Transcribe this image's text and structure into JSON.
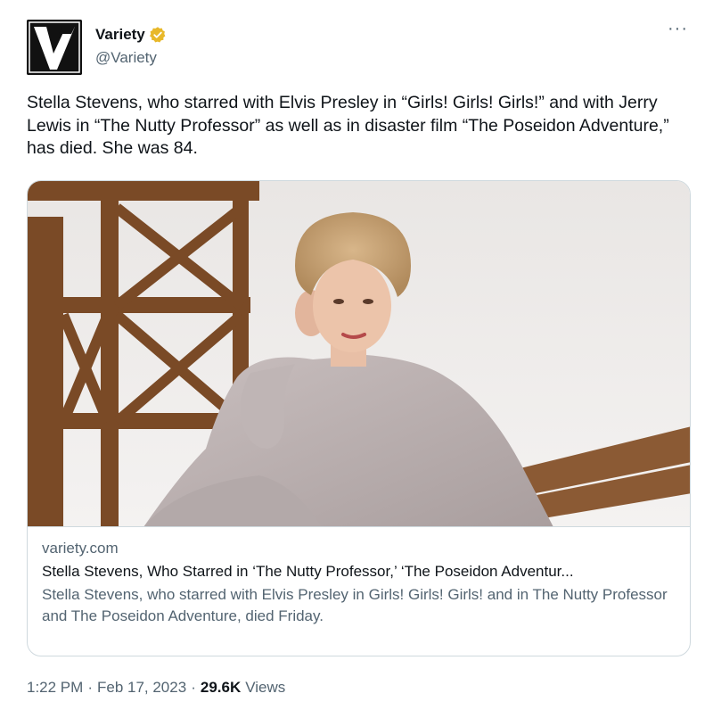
{
  "author": {
    "display_name": "Variety",
    "handle": "@Variety",
    "verified_icon": "verified-badge-icon",
    "verified_color": "#e8b829",
    "avatar_icon": "variety-logo"
  },
  "more_menu": {
    "label": "···"
  },
  "tweet": {
    "text": "Stella Stevens, who starred with Elvis Presley in “Girls! Girls! Girls!” and with Jerry Lewis in “The Nutty Professor” as well as in disaster film “The Poseidon Adventure,” has died. She was 84."
  },
  "card": {
    "domain": "variety.com",
    "title": "Stella Stevens, Who Starred in ‘The Nutty Professor,’ ‘The Poseidon Adventur...",
    "description": "Stella Stevens, who starred with Elvis Presley in Girls! Girls! Girls! and in The Nutty Professor and The Poseidon Adventure, died Friday.",
    "image_icon": "article-photo"
  },
  "meta": {
    "time": "1:22 PM",
    "date": "Feb 17, 2023",
    "views_count": "29.6K",
    "views_label": "Views",
    "separator": "·"
  },
  "colors": {
    "text_primary": "#0f1419",
    "text_secondary": "#536471",
    "border": "#cfd9de"
  }
}
